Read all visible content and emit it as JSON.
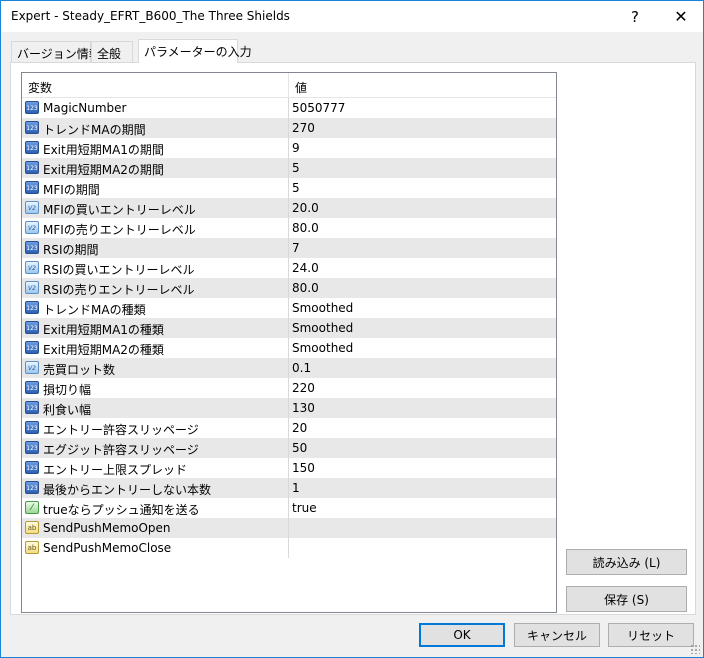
{
  "window": {
    "title": "Expert - Steady_EFRT_B600_The Three Shields",
    "help_label": "?",
    "close_label": "✕"
  },
  "tabs": [
    {
      "label": "バージョン情報"
    },
    {
      "label": "全般"
    },
    {
      "label": "パラメーターの入力"
    }
  ],
  "grid": {
    "col_variable": "変数",
    "col_value": "値",
    "rows": [
      {
        "icon": "int-type-icon",
        "icon_text": "123",
        "name": "MagicNumber",
        "value": "5050777"
      },
      {
        "icon": "int-type-icon",
        "icon_text": "123",
        "name": "トレンドMAの期間",
        "value": "270"
      },
      {
        "icon": "int-type-icon",
        "icon_text": "123",
        "name": "Exit用短期MA1の期間",
        "value": "9"
      },
      {
        "icon": "int-type-icon",
        "icon_text": "123",
        "name": "Exit用短期MA2の期間",
        "value": "5"
      },
      {
        "icon": "int-type-icon",
        "icon_text": "123",
        "name": "MFIの期間",
        "value": "5"
      },
      {
        "icon": "double-type-icon",
        "icon_text": "V2",
        "name": "MFIの買いエントリーレベル",
        "value": "20.0"
      },
      {
        "icon": "double-type-icon",
        "icon_text": "V2",
        "name": "MFIの売りエントリーレベル",
        "value": "80.0"
      },
      {
        "icon": "int-type-icon",
        "icon_text": "123",
        "name": "RSIの期間",
        "value": "7"
      },
      {
        "icon": "double-type-icon",
        "icon_text": "V2",
        "name": "RSIの買いエントリーレベル",
        "value": "24.0"
      },
      {
        "icon": "double-type-icon",
        "icon_text": "V2",
        "name": "RSIの売りエントリーレベル",
        "value": "80.0"
      },
      {
        "icon": "int-type-icon",
        "icon_text": "123",
        "name": "トレンドMAの種類",
        "value": "Smoothed"
      },
      {
        "icon": "int-type-icon",
        "icon_text": "123",
        "name": "Exit用短期MA1の種類",
        "value": "Smoothed"
      },
      {
        "icon": "int-type-icon",
        "icon_text": "123",
        "name": "Exit用短期MA2の種類",
        "value": "Smoothed"
      },
      {
        "icon": "double-type-icon",
        "icon_text": "V2",
        "name": "売買ロット数",
        "value": "0.1"
      },
      {
        "icon": "int-type-icon",
        "icon_text": "123",
        "name": "損切り幅",
        "value": "220"
      },
      {
        "icon": "int-type-icon",
        "icon_text": "123",
        "name": "利食い幅",
        "value": "130"
      },
      {
        "icon": "int-type-icon",
        "icon_text": "123",
        "name": "エントリー許容スリッページ",
        "value": "20"
      },
      {
        "icon": "int-type-icon",
        "icon_text": "123",
        "name": "エグジット許容スリッページ",
        "value": "50"
      },
      {
        "icon": "int-type-icon",
        "icon_text": "123",
        "name": "エントリー上限スプレッド",
        "value": "150"
      },
      {
        "icon": "int-type-icon",
        "icon_text": "123",
        "name": "最後からエントリーしない本数",
        "value": "1"
      },
      {
        "icon": "bool-type-icon",
        "icon_text": "⁄",
        "name": "trueならプッシュ通知を送る",
        "value": "true"
      },
      {
        "icon": "string-type-icon",
        "icon_text": "ab",
        "name": "SendPushMemoOpen",
        "value": ""
      },
      {
        "icon": "string-type-icon",
        "icon_text": "ab",
        "name": "SendPushMemoClose",
        "value": ""
      }
    ]
  },
  "side_buttons": {
    "load_label": "読み込み (L)",
    "save_label": "保存 (S)"
  },
  "footer": {
    "ok_label": "OK",
    "cancel_label": "キャンセル",
    "reset_label": "リセット"
  }
}
